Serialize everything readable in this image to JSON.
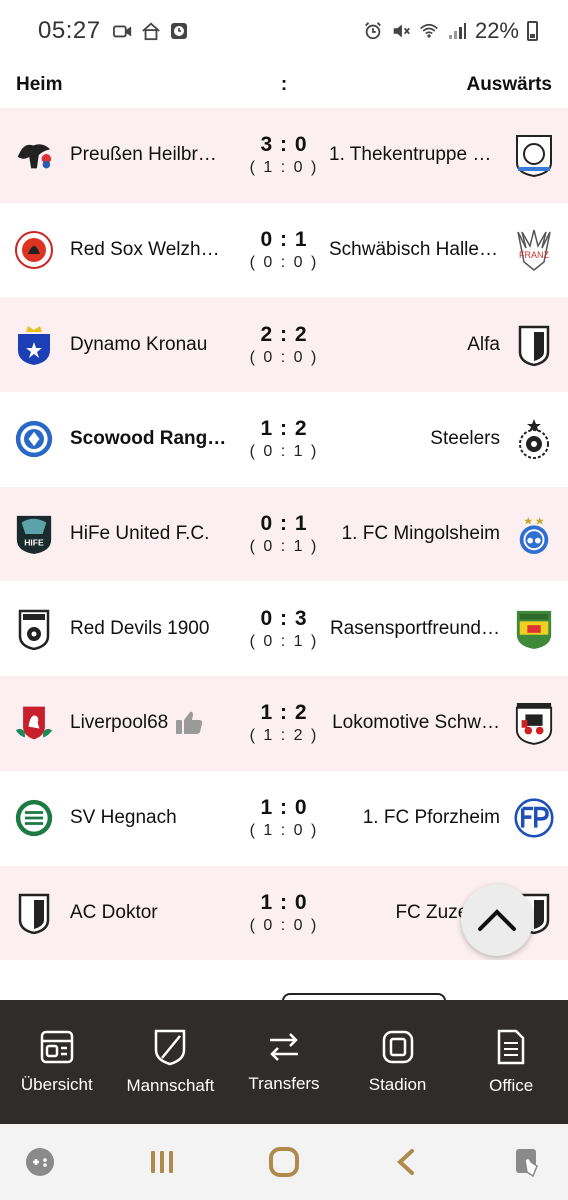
{
  "status_bar": {
    "time": "05:27",
    "battery": "22%",
    "icons": [
      "media-icon",
      "home-icon",
      "clock-app-icon",
      "alarm-icon",
      "mute-icon",
      "wifi-icon",
      "signal-icon",
      "battery-icon"
    ]
  },
  "header": {
    "home_label": "Heim",
    "separator": ":",
    "away_label": "Auswärts"
  },
  "matches": [
    {
      "home": "Preußen Heilbr…",
      "ft": "3 : 0",
      "ht": "( 1 : 0 )",
      "away": "1. Thekentruppe E…",
      "home_bold": false
    },
    {
      "home": "Red Sox Welzh…",
      "ft": "0 : 1",
      "ht": "( 0 : 0 )",
      "away": "Schwäbisch Haller…",
      "home_bold": false
    },
    {
      "home": "Dynamo Kronau",
      "ft": "2 : 2",
      "ht": "( 0 : 0 )",
      "away": "Alfa",
      "home_bold": false
    },
    {
      "home": "Scowood Rang…",
      "ft": "1 : 2",
      "ht": "( 0 : 1 )",
      "away": "Steelers",
      "home_bold": true
    },
    {
      "home": "HiFe United F.C.",
      "ft": "0 : 1",
      "ht": "( 0 : 1 )",
      "away": "1. FC Mingolsheim",
      "home_bold": false
    },
    {
      "home": "Red Devils 1900",
      "ft": "0 : 3",
      "ht": "( 0 : 1 )",
      "away": "Rasensportfreund…",
      "home_bold": false
    },
    {
      "home": "Liverpool68",
      "ft": "1 : 2",
      "ht": "( 1 : 2 )",
      "away": "Lokomotive Schw…",
      "home_bold": false
    },
    {
      "home": "SV Hegnach",
      "ft": "1 : 0",
      "ht": "( 1 : 0 )",
      "away": "1. FC Pforzheim",
      "home_bold": false
    },
    {
      "home": "AC Doktor",
      "ft": "1 : 0",
      "ht": "( 0 : 0 )",
      "away": "FC Zuzenha",
      "home_bold": false
    }
  ],
  "bottom_nav": [
    {
      "label": "Übersicht",
      "icon": "overview-icon"
    },
    {
      "label": "Mannschaft",
      "icon": "team-shield-icon"
    },
    {
      "label": "Transfers",
      "icon": "transfer-arrows-icon"
    },
    {
      "label": "Stadion",
      "icon": "stadium-icon"
    },
    {
      "label": "Office",
      "icon": "office-document-icon"
    }
  ],
  "colors": {
    "row_alt": "#fbeff1",
    "nav_bg": "#302c2b",
    "sysnav_bg": "#f3f3f3"
  }
}
